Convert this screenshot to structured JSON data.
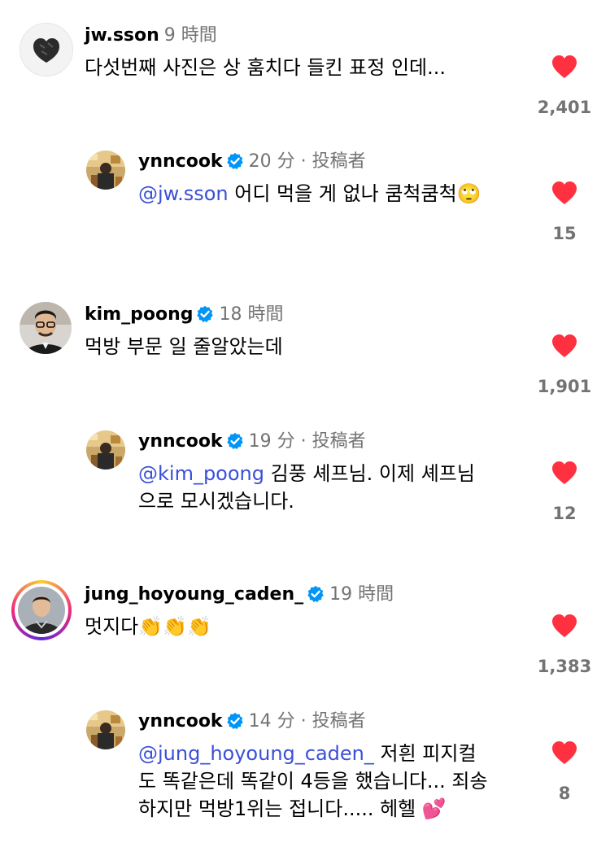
{
  "author_tag": "投稿者",
  "separator": "·",
  "comments": [
    {
      "username": "jw.sson",
      "time": "9 時間",
      "verified": false,
      "text": "다섯번째 사진은 상 훔치다 들킨 표정 인데...",
      "likes": "2,401",
      "avatar": "heart-object-avatar"
    },
    {
      "username": "ynncook",
      "time": "20 分",
      "verified": true,
      "mention": "@jw.sson",
      "text": "어디 먹을 게 없나 쿰척쿰척",
      "emoji": "🙄",
      "likes": "15",
      "avatar": "chef-avatar"
    },
    {
      "username": "kim_poong",
      "time": "18 時間",
      "verified": true,
      "text": "먹방 부문 일 줄알았는데",
      "likes": "1,901",
      "avatar": "man-glasses-avatar"
    },
    {
      "username": "ynncook",
      "time": "19 分",
      "verified": true,
      "mention": "@kim_poong",
      "text_line1": "김풍 셰프님. 이제 셰프님",
      "text_line2": "으로 모시겠습니다.",
      "likes": "12",
      "avatar": "chef-avatar"
    },
    {
      "username": "jung_hoyoung_caden_",
      "time": "19 時間",
      "verified": true,
      "text": "멋지다",
      "emoji": "👏👏👏",
      "likes": "1,383",
      "avatar": "chef-man-story-avatar"
    },
    {
      "username": "ynncook",
      "time": "14 分",
      "verified": true,
      "mention": "@jung_hoyoung_caden_",
      "text_line1": "저흰 피지컬",
      "text_line2": "도 똑같은데 똑같이 4등을 했습니다... 죄송",
      "text_line3": "하지만 먹방1위는 접니다..... 헤헬",
      "emoji": "💕",
      "likes": "8",
      "avatar": "chef-avatar"
    }
  ],
  "colors": {
    "heart": "#ff3040",
    "mention": "#3a4fd8",
    "muted": "#737373",
    "verified": "#0095f6"
  }
}
